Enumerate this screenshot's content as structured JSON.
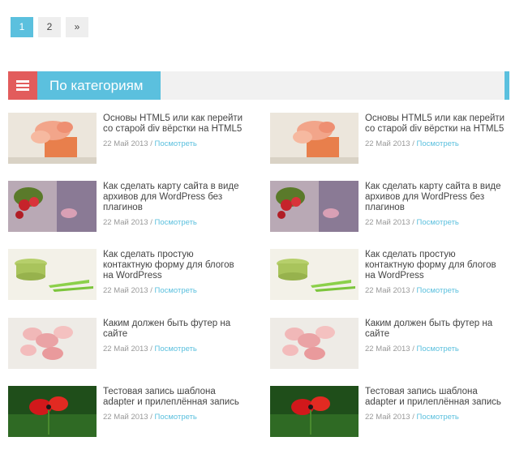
{
  "pagination": {
    "pages": [
      "1",
      "2"
    ],
    "next": "»",
    "active": "1"
  },
  "section": {
    "title": "По категориям",
    "icon": "hamburger-menu-icon"
  },
  "colors": {
    "accent_blue": "#5bc0de",
    "accent_red": "#e25c5c",
    "header_bg": "#f1f1f1"
  },
  "posts": [
    {
      "title": "Основы HTML5 или как перейти со старой div вёрстки на HTML5",
      "date": "22 Май 2013",
      "sep": " / ",
      "read": "Посмотреть",
      "image": "orange-flower"
    },
    {
      "title": "Как сделать карту сайта в виде архивов для WordPress без плагинов",
      "date": "22 Май 2013",
      "sep": " / ",
      "read": "Посмотреть",
      "image": "red-berries"
    },
    {
      "title": "Как сделать простую контактную форму для блогов на WordPress",
      "date": "22 Май 2013",
      "sep": " / ",
      "read": "Посмотреть",
      "image": "green-bowls"
    },
    {
      "title": "Каким должен быть футер на сайте",
      "date": "22 Май 2013",
      "sep": " / ",
      "read": "Посмотреть",
      "image": "pink-orchids"
    },
    {
      "title": "Тестовая запись шаблона adapter и прилеплённая запись",
      "date": "22 Май 2013",
      "sep": " / ",
      "read": "Посмотреть",
      "image": "red-poppy"
    }
  ]
}
